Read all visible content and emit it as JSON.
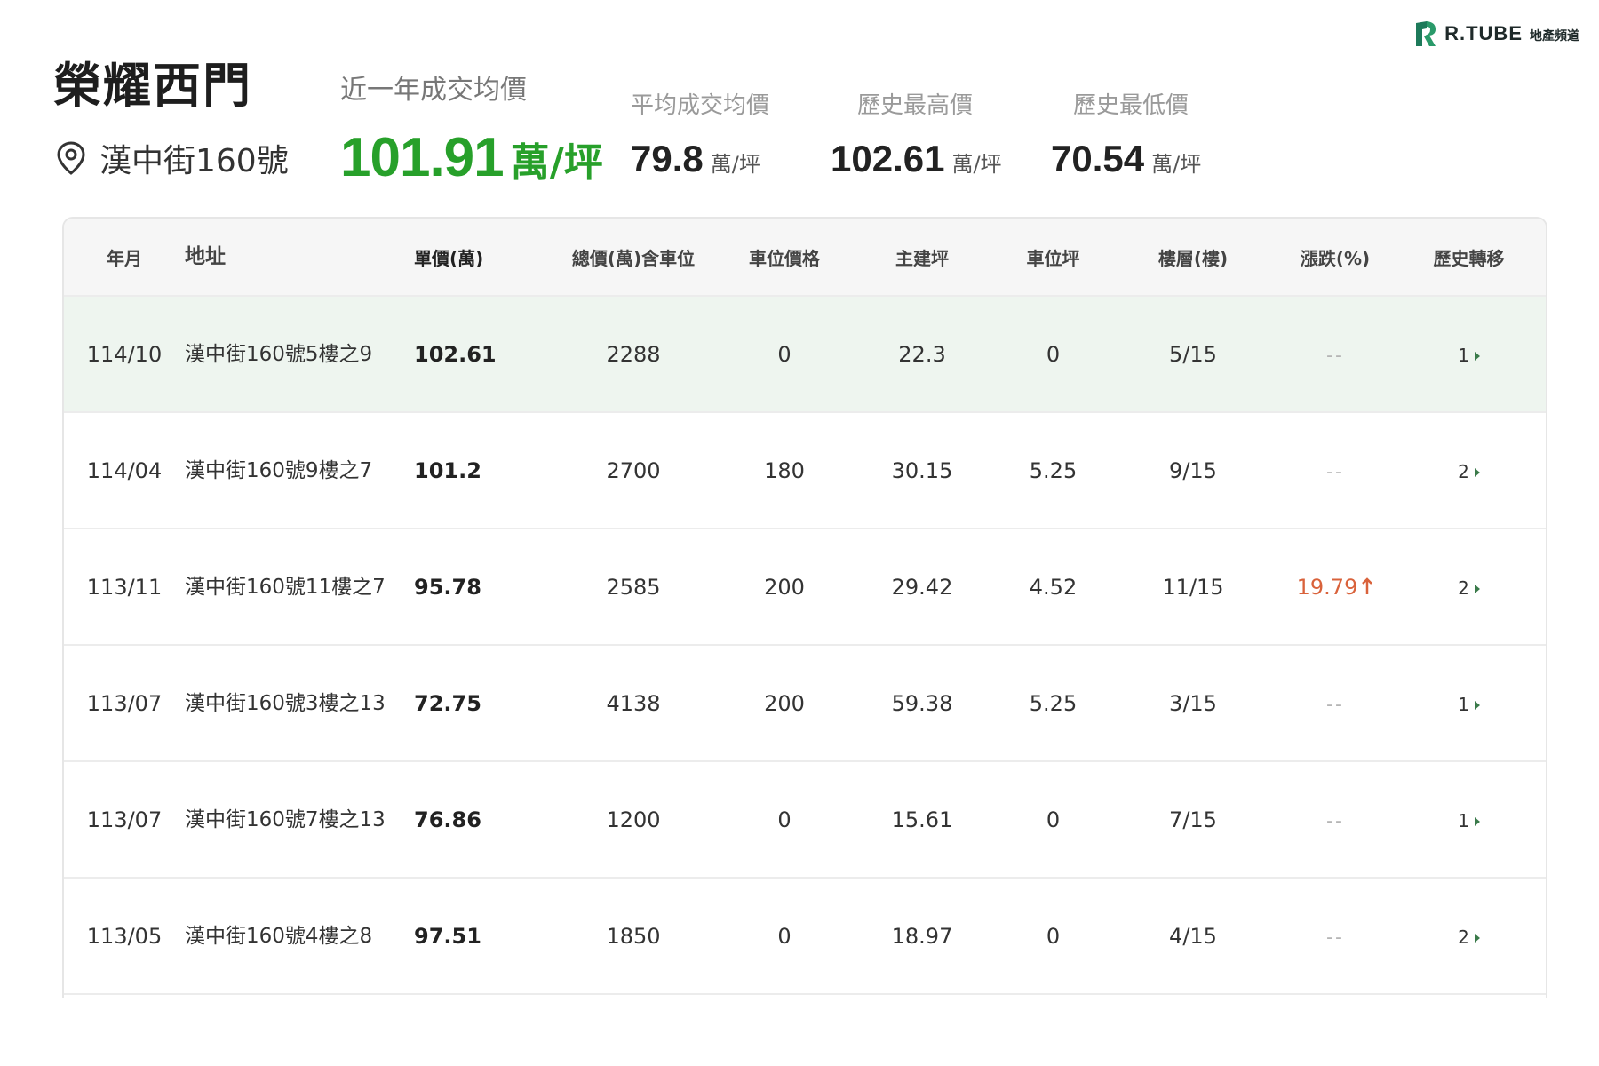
{
  "brand": {
    "name": "R.TUBE",
    "sub": "地產頻道",
    "accent": "#1d7a5a"
  },
  "building": {
    "name": "榮耀西門",
    "address": "漢中街160號"
  },
  "stats": {
    "recent": {
      "label": "近一年成交均價",
      "value": "101.91",
      "unit": "萬/坪",
      "color": "#27a02a"
    },
    "average": {
      "label": "平均成交均價",
      "value": "79.8",
      "unit": "萬/坪"
    },
    "highest": {
      "label": "歷史最高價",
      "value": "102.61",
      "unit": "萬/坪"
    },
    "lowest": {
      "label": "歷史最低價",
      "value": "70.54",
      "unit": "萬/坪"
    }
  },
  "table": {
    "headers": {
      "date": "年月",
      "address": "地址",
      "unit_price": "單價(萬)",
      "total": "總價(萬)含車位",
      "parking_price": "車位價格",
      "main_area": "主建坪",
      "parking_area": "車位坪",
      "floor": "樓層(樓)",
      "change": "漲跌(%)",
      "history": "歷史轉移"
    },
    "rows": [
      {
        "date": "114/10",
        "address": "漢中街160號5樓之9",
        "unit_price": "102.61",
        "total": "2288",
        "parking_price": "0",
        "main_area": "22.3",
        "parking_area": "0",
        "floor": "5/15",
        "change": "--",
        "history": "1"
      },
      {
        "date": "114/04",
        "address": "漢中街160號9樓之7",
        "unit_price": "101.2",
        "total": "2700",
        "parking_price": "180",
        "main_area": "30.15",
        "parking_area": "5.25",
        "floor": "9/15",
        "change": "--",
        "history": "2"
      },
      {
        "date": "113/11",
        "address": "漢中街160號11樓之7",
        "unit_price": "95.78",
        "total": "2585",
        "parking_price": "200",
        "main_area": "29.42",
        "parking_area": "4.52",
        "floor": "11/15",
        "change": "19.79",
        "history": "2"
      },
      {
        "date": "113/07",
        "address": "漢中街160號3樓之13",
        "unit_price": "72.75",
        "total": "4138",
        "parking_price": "200",
        "main_area": "59.38",
        "parking_area": "5.25",
        "floor": "3/15",
        "change": "--",
        "history": "1"
      },
      {
        "date": "113/07",
        "address": "漢中街160號7樓之13",
        "unit_price": "76.86",
        "total": "1200",
        "parking_price": "0",
        "main_area": "15.61",
        "parking_area": "0",
        "floor": "7/15",
        "change": "--",
        "history": "1"
      },
      {
        "date": "113/05",
        "address": "漢中街160號4樓之8",
        "unit_price": "97.51",
        "total": "1850",
        "parking_price": "0",
        "main_area": "18.97",
        "parking_area": "0",
        "floor": "4/15",
        "change": "--",
        "history": "2"
      }
    ],
    "highlight_color": "#eef5ef",
    "rise_color": "#d9623b"
  }
}
